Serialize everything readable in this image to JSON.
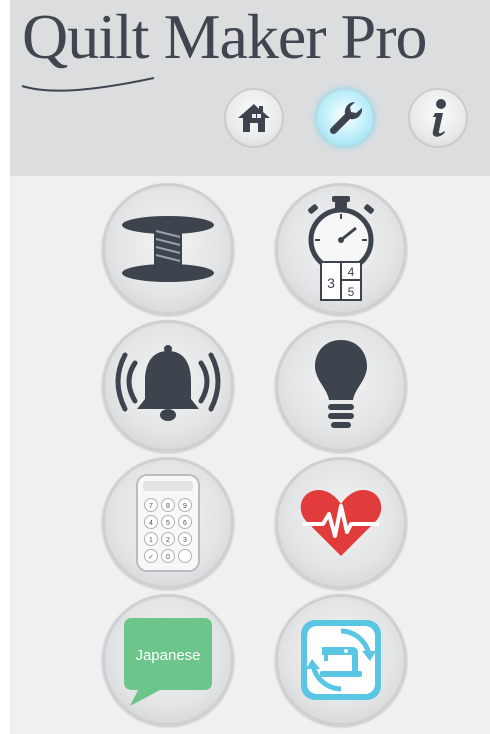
{
  "app": {
    "title": "Quilt Maker Pro"
  },
  "nav": [
    {
      "name": "home",
      "icon": "home-icon",
      "active": false
    },
    {
      "name": "settings",
      "icon": "wrench-icon",
      "active": true
    },
    {
      "name": "info",
      "icon": "info-icon",
      "active": false
    }
  ],
  "tiles": [
    {
      "name": "bobbin",
      "icon": "bobbin-icon"
    },
    {
      "name": "stitch-timer",
      "icon": "stopwatch-icon",
      "digits": [
        "3",
        "4",
        "5"
      ]
    },
    {
      "name": "alarm",
      "icon": "bell-icon"
    },
    {
      "name": "light",
      "icon": "lightbulb-icon"
    },
    {
      "name": "keypad",
      "icon": "keypad-icon",
      "keys": [
        "7",
        "8",
        "9",
        "4",
        "5",
        "6",
        "1",
        "2",
        "3",
        "✓",
        "0",
        ""
      ]
    },
    {
      "name": "health",
      "icon": "heart-rate-icon"
    },
    {
      "name": "language",
      "icon": "speech-bubble-icon",
      "label": "Japanese"
    },
    {
      "name": "machine-sync",
      "icon": "sewing-machine-sync-icon"
    }
  ],
  "colors": {
    "header_bg": "#dcdddf",
    "body_bg": "#f0f0f0",
    "icon_dark": "#3d444e",
    "active_glow": "#8fdcef",
    "heart_red": "#e23b3b",
    "language_green": "#6cc58a",
    "sync_blue": "#5bc6e4"
  }
}
